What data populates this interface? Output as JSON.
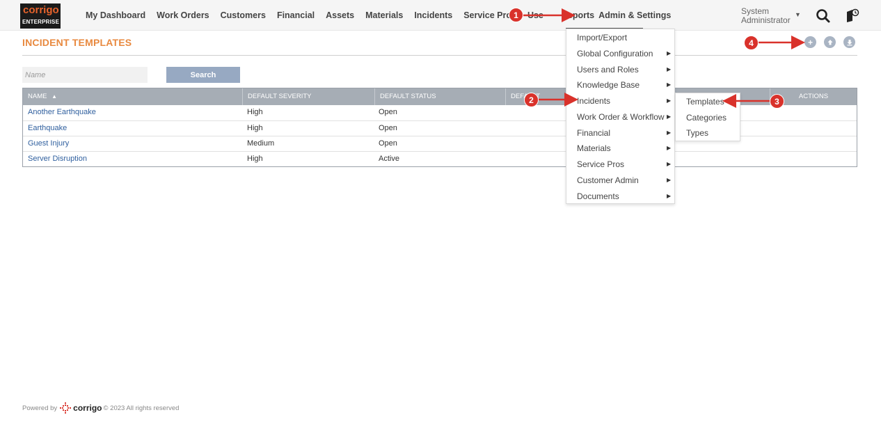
{
  "logo": {
    "line1": "corrigo",
    "line2": "ENTERPRISE"
  },
  "nav": {
    "items": [
      "My Dashboard",
      "Work Orders",
      "Customers",
      "Financial",
      "Assets",
      "Materials",
      "Incidents",
      "Service Pros",
      "Use",
      "Reports",
      "Admin & Settings"
    ]
  },
  "user": {
    "line1": "System",
    "line2": "Administrator"
  },
  "page": {
    "title": "INCIDENT TEMPLATES"
  },
  "search": {
    "placeholder": "Name",
    "button": "Search"
  },
  "table": {
    "columns": [
      "NAME",
      "DEFAULT SEVERITY",
      "DEFAULT STATUS",
      "DEFAULT",
      "ACTIONS"
    ],
    "rows": [
      {
        "name": "Another Earthquake",
        "severity": "High",
        "status": "Open"
      },
      {
        "name": "Earthquake",
        "severity": "High",
        "status": "Open"
      },
      {
        "name": "Guest Injury",
        "severity": "Medium",
        "status": "Open"
      },
      {
        "name": "Server Disruption",
        "severity": "High",
        "status": "Active"
      }
    ]
  },
  "menu": {
    "items": [
      "Import/Export",
      "Global Configuration",
      "Users and Roles",
      "Knowledge Base",
      "Incidents",
      "Work Order & Workflow",
      "Financial",
      "Materials",
      "Service Pros",
      "Customer Admin",
      "Documents"
    ]
  },
  "submenu": {
    "items": [
      "Templates",
      "Categories",
      "Types"
    ]
  },
  "annotations": {
    "badges": [
      "1",
      "2",
      "3",
      "4"
    ],
    "color": "#d9322b"
  },
  "footer": {
    "powered": "Powered by",
    "brand": "corrigo",
    "rights": "© 2023 All rights reserved"
  },
  "colors": {
    "accent": "#e8893f",
    "link": "#2f5f9e",
    "header": "#a6adb5",
    "button": "#97a9c2"
  }
}
